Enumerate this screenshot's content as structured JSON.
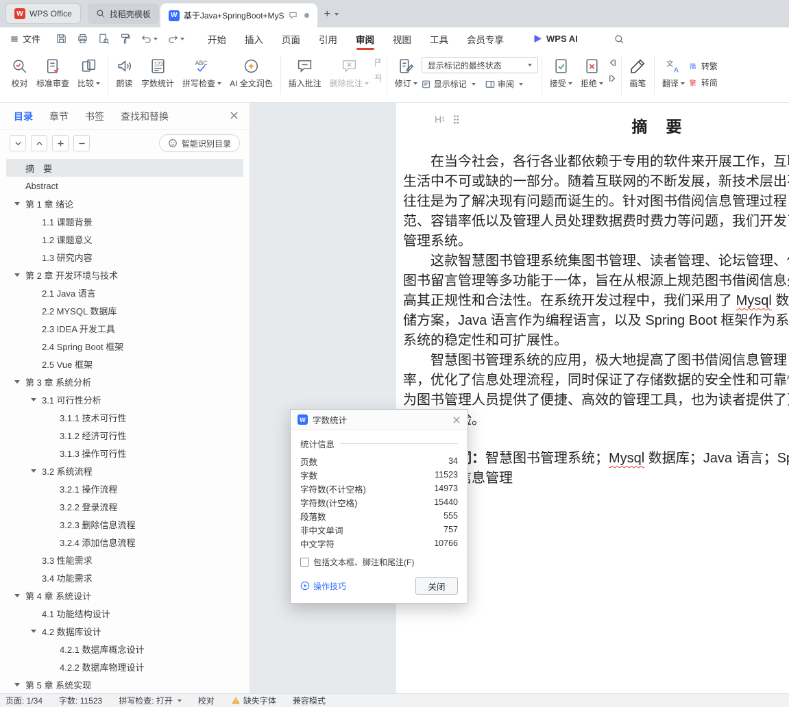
{
  "window": {
    "tabs": [
      {
        "label": "WPS Office"
      },
      {
        "label": "找稻壳模板"
      },
      {
        "label": "基于Java+SpringBoot+MyS",
        "active": true,
        "modified": true
      }
    ]
  },
  "menu": {
    "file": "文件",
    "items": [
      "开始",
      "插入",
      "页面",
      "引用",
      "审阅",
      "视图",
      "工具",
      "会员专享"
    ],
    "active": "审阅",
    "wps_ai": "WPS AI"
  },
  "ribbon": {
    "proofread": "校对",
    "standard_review": "标准审查",
    "compare": "比较",
    "read_aloud": "朗读",
    "word_count": "字数统计",
    "spell_check": "拼写检查",
    "ai_polish": "AI 全文润色",
    "insert_comment": "插入批注",
    "delete_comment": "删除批注",
    "track_changes": "修订",
    "markup_state": "显示标记的最终状态",
    "show_markup": "显示标记",
    "review_pane": "审阅",
    "accept": "接受",
    "reject": "拒绝",
    "brush": "画笔",
    "translate": "翻译",
    "to_traditional": "转繁",
    "to_simplified": "转简"
  },
  "sidebar": {
    "tabs": [
      "目录",
      "章节",
      "书签",
      "查找和替换"
    ],
    "active_tab": "目录",
    "smart_toc": "智能识别目录",
    "outline": [
      {
        "label": "摘　要",
        "level": 0,
        "selected": true
      },
      {
        "label": "Abstract",
        "level": 0
      },
      {
        "label": "第 1 章 绪论",
        "level": 0,
        "caret": true
      },
      {
        "label": "1.1 课题背景",
        "level": 1
      },
      {
        "label": "1.2 课题意义",
        "level": 1
      },
      {
        "label": "1.3 研究内容",
        "level": 1
      },
      {
        "label": "第 2 章 开发环境与技术",
        "level": 0,
        "caret": true
      },
      {
        "label": "2.1 Java 语言",
        "level": 1
      },
      {
        "label": "2.2 MYSQL 数据库",
        "level": 1
      },
      {
        "label": "2.3 IDEA 开发工具",
        "level": 1
      },
      {
        "label": "2.4 Spring Boot 框架",
        "level": 1
      },
      {
        "label": "2.5 Vue 框架",
        "level": 1
      },
      {
        "label": "第 3 章 系统分析",
        "level": 0,
        "caret": true
      },
      {
        "label": "3.1 可行性分析",
        "level": 1,
        "caret": true
      },
      {
        "label": "3.1.1 技术可行性",
        "level": 2
      },
      {
        "label": "3.1.2 经济可行性",
        "level": 2
      },
      {
        "label": "3.1.3 操作可行性",
        "level": 2
      },
      {
        "label": "3.2 系统流程",
        "level": 1,
        "caret": true
      },
      {
        "label": "3.2.1 操作流程",
        "level": 2
      },
      {
        "label": "3.2.2 登录流程",
        "level": 2
      },
      {
        "label": "3.2.3 删除信息流程",
        "level": 2
      },
      {
        "label": "3.2.4 添加信息流程",
        "level": 2
      },
      {
        "label": "3.3 性能需求",
        "level": 1
      },
      {
        "label": "3.4 功能需求",
        "level": 1
      },
      {
        "label": "第 4 章 系统设计",
        "level": 0,
        "caret": true
      },
      {
        "label": "4.1 功能结构设计",
        "level": 1
      },
      {
        "label": "4.2 数据库设计",
        "level": 1,
        "caret": true
      },
      {
        "label": "4.2.1 数据库概念设计",
        "level": 2
      },
      {
        "label": "4.2.2 数据库物理设计",
        "level": 2
      },
      {
        "label": "第 5 章 系统实现",
        "level": 0,
        "caret": true
      }
    ]
  },
  "document": {
    "title": "摘　要",
    "lines": [
      {
        "indent": true,
        "segments": [
          {
            "t": "在当今社会，各行各业都依赖于专用的软件来开展工作，互联"
          }
        ]
      },
      {
        "segments": [
          {
            "t": "生活中不可或缺的一部分。随着互联网的不断发展，新技术层出不"
          }
        ]
      },
      {
        "segments": [
          {
            "t": "往往是为了解决现有问题而诞生的。针对图书借阅信息管理过程"
          }
        ]
      },
      {
        "segments": [
          {
            "t": "范、容错率低以及管理人员处理数据费时费力等问题，我们开发了"
          }
        ]
      },
      {
        "segments": [
          {
            "t": "管理系统。"
          }
        ]
      },
      {
        "indent": true,
        "segments": [
          {
            "t": "这款智慧图书管理系统集图书管理、读者管理、论坛管理、借"
          }
        ]
      },
      {
        "segments": [
          {
            "t": "图书留言管理等多功能于一体，旨在从根源上规范图书借阅信息处"
          }
        ]
      },
      {
        "segments": [
          {
            "t": "高其正规性和合法性。在系统开发过程中，我们采用了 "
          },
          {
            "t": "Mysql",
            "style": "squiggle"
          },
          {
            "t": " 数据"
          }
        ]
      },
      {
        "segments": [
          {
            "t": "储方案，Java 语言作为编程语言，以及 Spring Boot 框架作为系统"
          }
        ]
      },
      {
        "segments": [
          {
            "t": "系统的稳定性和可扩展性。"
          }
        ]
      },
      {
        "indent": true,
        "segments": [
          {
            "t": "智慧图书管理系统的应用，极大地提高了图书借阅信息管理"
          }
        ]
      },
      {
        "segments": [
          {
            "t": "率，优化了信息处理流程，同时保证了存储数据的安全性和可靠性"
          }
        ]
      },
      {
        "segments": [
          {
            "t": "为图书管理人员提供了便捷、高效的管理工具，也为读者提供了更"
          }
        ]
      },
      {
        "segments": [
          {
            "t": "的借阅体验。"
          }
        ]
      },
      {
        "blank": true
      },
      {
        "indent": true,
        "segments": [
          {
            "t": "关键词：",
            "style": "bold"
          },
          {
            "t": "智慧图书管理系统；"
          },
          {
            "t": "Mysql",
            "style": "squiggle"
          },
          {
            "t": " 数据库；Java 语言；Spri"
          }
        ]
      },
      {
        "segments": [
          {
            "t": "图书借阅信息管理"
          }
        ]
      }
    ]
  },
  "word_count_dialog": {
    "title": "字数统计",
    "group": "统计信息",
    "rows": [
      {
        "label": "页数",
        "value": "34"
      },
      {
        "label": "字数",
        "value": "11523"
      },
      {
        "label": "字符数(不计空格)",
        "value": "14973"
      },
      {
        "label": "字符数(计空格)",
        "value": "15440"
      },
      {
        "label": "段落数",
        "value": "555"
      },
      {
        "label": "非中文单词",
        "value": "757"
      },
      {
        "label": "中文字符",
        "value": "10766"
      }
    ],
    "checkbox_label": "包括文本框、脚注和尾注(F)",
    "tips_link": "操作技巧",
    "close_button": "关闭"
  },
  "status_bar": {
    "page": "页面: 1/34",
    "words": "字数: 11523",
    "spell": "拼写检查: 打开",
    "proof": "校对",
    "missing_font": "缺失字体",
    "compat": "兼容模式"
  },
  "colors": {
    "accent_red": "#e23f31",
    "doc_blue": "#3370ff",
    "link_blue": "#3370ff",
    "warning_orange": "#f0a32f"
  },
  "icons": {
    "search-icon": "magnifier",
    "caret-down-icon": "triangle-down",
    "close-icon": "x-cross",
    "warning-icon": "orange-triangle-exclamation",
    "wps-logo": "red W square",
    "writer-logo": "blue W square"
  }
}
